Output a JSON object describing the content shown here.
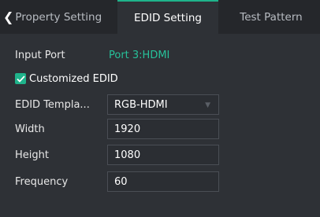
{
  "tabs": {
    "property": "Property Setting",
    "edid": "EDID Setting",
    "test": "Test Pattern"
  },
  "input_port": {
    "label": "Input Port",
    "value": "Port 3:HDMI"
  },
  "customized": {
    "label": "Customized EDID",
    "checked": true
  },
  "template": {
    "label": "EDID Templa...",
    "value": "RGB-HDMI"
  },
  "width": {
    "label": "Width",
    "value": "1920"
  },
  "height": {
    "label": "Height",
    "value": "1080"
  },
  "frequency": {
    "label": "Frequency",
    "value": "60"
  },
  "colors": {
    "accent": "#1fb38b",
    "panel": "#2e3136",
    "background": "#25272b"
  },
  "icons": [
    "chevron-left-icon",
    "checkmark-icon",
    "dropdown-arrow-icon"
  ]
}
